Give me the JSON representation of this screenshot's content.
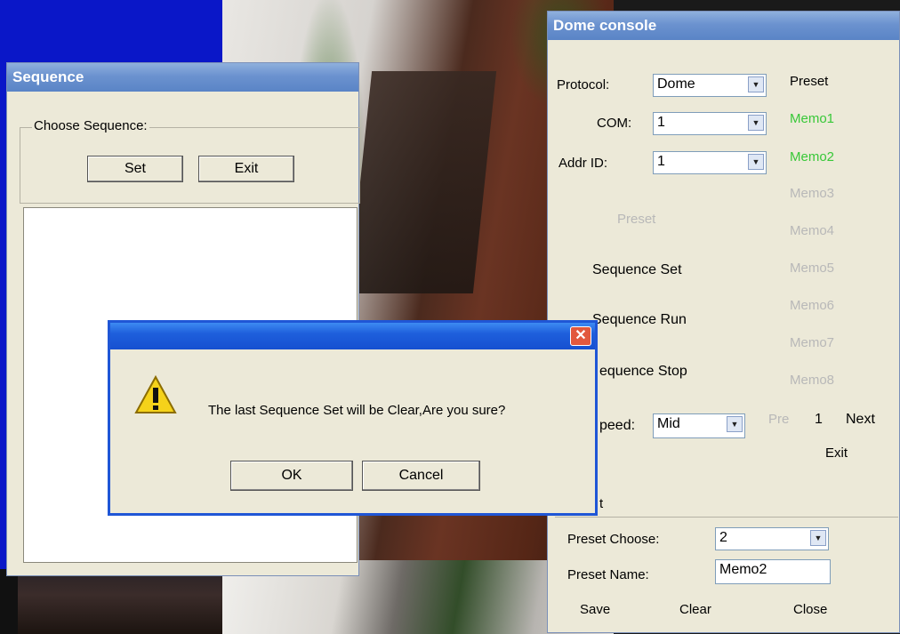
{
  "sequence_window": {
    "title": "Sequence",
    "group_label": "Choose Sequence:",
    "set_label": "Set",
    "exit_label": "Exit"
  },
  "dome_console": {
    "title": "Dome console",
    "protocol_label": "Protocol:",
    "protocol_value": "Dome",
    "com_label": "COM:",
    "com_value": "1",
    "addr_label": "Addr ID:",
    "addr_value": "1",
    "preset_header": "Preset",
    "preset_button": "Preset",
    "sequence_set": "Sequence Set",
    "sequence_run": "Sequence Run",
    "sequence_stop": "equence Stop",
    "speed_label": "peed:",
    "speed_value": "Mid",
    "memos": [
      "Memo1",
      "Memo2",
      "Memo3",
      "Memo4",
      "Memo5",
      "Memo6",
      "Memo7",
      "Memo8"
    ],
    "pre_label": "Pre",
    "page_number": "1",
    "next_label": "Next",
    "exit_label": "Exit",
    "preset_group_label": "t",
    "preset_choose_label": "Preset Choose:",
    "preset_choose_value": "2",
    "preset_name_label": "Preset Name:",
    "preset_name_value": "Memo2",
    "save_label": "Save",
    "clear_label": "Clear",
    "close_label": "Close"
  },
  "dialog": {
    "message": "The last Sequence Set will be Clear,Are you sure?",
    "ok_label": "OK",
    "cancel_label": "Cancel",
    "icon": "warning-icon"
  },
  "colors": {
    "title_bar": "#6b92cf",
    "dialog_title": "#1e5fdc",
    "active_memo": "#38c838",
    "disabled_text": "#b8b8b8",
    "close_button": "#e2583d"
  }
}
